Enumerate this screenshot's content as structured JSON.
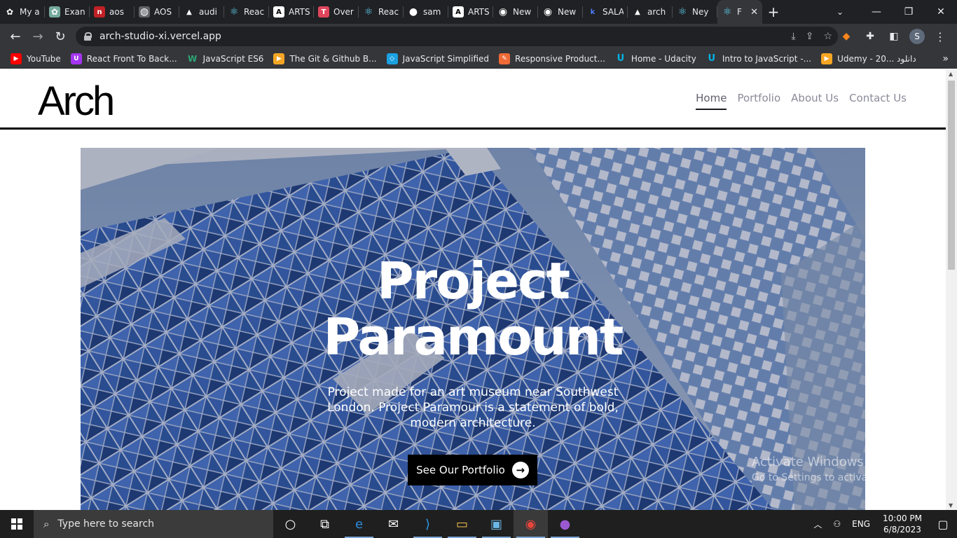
{
  "browser": {
    "tabs": [
      {
        "title": "My a",
        "icon": "openai-icon",
        "color": "#202124"
      },
      {
        "title": "Exan",
        "icon": "chatgpt-icon",
        "color": "#74aa9c"
      },
      {
        "title": "aos",
        "icon": "npm-icon",
        "color": "#c12127"
      },
      {
        "title": "AOS",
        "icon": "globe-icon",
        "color": "#5f6368"
      },
      {
        "title": "audi",
        "icon": "vercel-icon",
        "color": "#202124"
      },
      {
        "title": "Reac",
        "icon": "react-icon",
        "color": "#202124"
      },
      {
        "title": "ARTS",
        "icon": "a-logo-icon",
        "color": "#ffffff"
      },
      {
        "title": "Over",
        "icon": "t-logo-icon",
        "color": "#e0465b"
      },
      {
        "title": "Reac",
        "icon": "react-redux-icon",
        "color": "#202124"
      },
      {
        "title": "sam",
        "icon": "github-icon",
        "color": "#202124"
      },
      {
        "title": "ARTS",
        "icon": "a-logo-icon",
        "color": "#ffffff"
      },
      {
        "title": "New",
        "icon": "chrome-icon",
        "color": "#202124"
      },
      {
        "title": "New",
        "icon": "chrome-icon",
        "color": "#202124"
      },
      {
        "title": "SALA",
        "icon": "k-logo-icon",
        "color": "#202124"
      },
      {
        "title": "arch",
        "icon": "vercel-icon",
        "color": "#202124"
      },
      {
        "title": "Ney",
        "icon": "react-icon",
        "color": "#202124"
      },
      {
        "title": "F",
        "icon": "react-icon",
        "color": "#35363a",
        "active": true
      }
    ],
    "new_tab_label": "+",
    "url": "arch-studio-xi.vercel.app",
    "profile_initial": "S",
    "bookmarks": [
      {
        "label": "YouTube",
        "icon": "youtube-icon",
        "color": "#ff0000"
      },
      {
        "label": "React Front To Back...",
        "icon": "udemy-icon",
        "color": "#a435f0"
      },
      {
        "label": "JavaScript ES6",
        "icon": "w-logo-icon",
        "color": "#2aa876"
      },
      {
        "label": "The Git & Github B...",
        "icon": "play-icon",
        "color": "#f5a623"
      },
      {
        "label": "JavaScript Simplified",
        "icon": "course-icon",
        "color": "#1ba1e2"
      },
      {
        "label": "Responsive Product...",
        "icon": "pencil-icon",
        "color": "#f06a35"
      },
      {
        "label": "Home - Udacity",
        "icon": "udacity-icon",
        "color": "#02b3e4"
      },
      {
        "label": "Intro to JavaScript -...",
        "icon": "udacity-icon",
        "color": "#02b3e4"
      },
      {
        "label": "Udemy - 20... دانلود",
        "icon": "play-icon",
        "color": "#f5a623"
      }
    ]
  },
  "site": {
    "logo": "Arch",
    "nav": [
      {
        "label": "Home",
        "active": true
      },
      {
        "label": "Portfolio"
      },
      {
        "label": "About Us"
      },
      {
        "label": "Contact Us"
      }
    ],
    "hero": {
      "title_line1": "Project",
      "title_line2": "Paramount",
      "description": "Project made for an art museum near Southwest London. Project Paramour is a statement of bold, modern architecture.",
      "cta_label": "See Our Portfolio"
    }
  },
  "watermark": {
    "line1": "Activate Windows",
    "line2": "Go to Settings to activate Windows."
  },
  "taskbar": {
    "search_placeholder": "Type here to search",
    "apps": [
      {
        "name": "cortana-icon",
        "glyph": "○"
      },
      {
        "name": "task-view-icon",
        "glyph": "⧉"
      },
      {
        "name": "edge-icon",
        "glyph": "e"
      },
      {
        "name": "mail-icon",
        "glyph": "✉"
      },
      {
        "name": "vscode-icon",
        "glyph": "⟩"
      },
      {
        "name": "file-explorer-icon",
        "glyph": "▭"
      },
      {
        "name": "photos-icon",
        "glyph": "▣"
      },
      {
        "name": "chrome-icon",
        "glyph": "◉"
      },
      {
        "name": "github-desktop-icon",
        "glyph": "●"
      }
    ],
    "language": "ENG",
    "time": "10:00 PM",
    "date": "6/8/2023"
  }
}
